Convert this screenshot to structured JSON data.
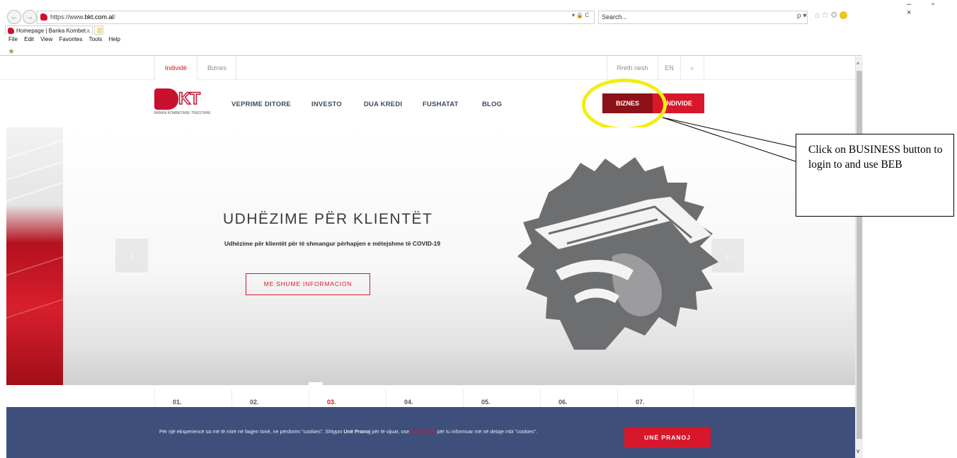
{
  "browser": {
    "url_prefix": "https://www.",
    "url_domain": "bkt.com.al",
    "url_suffix": "/",
    "address_tools": "▾ 🔒 C",
    "search_placeholder": "Search...",
    "search_dropdown": "ρ ▾",
    "tab_title": "Homepage | Banka Kombet...",
    "tab_close": "×",
    "menu": [
      "File",
      "Edit",
      "View",
      "Favorites",
      "Tools",
      "Help"
    ],
    "window_controls": "– ▫ ×"
  },
  "site": {
    "top_tabs": [
      "Individë",
      "Biznes"
    ],
    "top_links": [
      "Rreth nesh",
      "EN"
    ],
    "search_glyph": "⌕",
    "logo_letters": "KT",
    "logo_sub": "BANKA KOMBETARE TREGTARE",
    "nav": [
      "VEPRIME DITORE",
      "INVESTO",
      "DUA KREDI",
      "FUSHATAT",
      "BLOG"
    ],
    "btn_biznes": "BIZNES",
    "btn_individe": "INDIVIDE"
  },
  "hero": {
    "title": "UDHËZIME PËR KLIENTËT",
    "subtitle": "Udhëzime për klientët për të shmangur përhapjen e mëtejshme të COVID-19",
    "button": "ME SHUME INFORMACION",
    "arrow_left": "‹",
    "arrow_right": "›"
  },
  "slides": {
    "numbers": [
      "01.",
      "02.",
      "03.",
      "04.",
      "05.",
      "06.",
      "07."
    ],
    "active_index": 2
  },
  "cookie": {
    "text_part1": "Për një eksperiencë sa më të mirë në faqjen tonë, ne përdorim \"cookies\". Shtypni ",
    "text_bold": "Unë Pranoj",
    "text_part2": " për të vijuar, ose ",
    "link": "klikoni këtu",
    "text_part3": " për tu informuar më në detaje mbi \"cookies\".",
    "button": "UNË PRANOJ"
  },
  "annotation": {
    "callout_text": "Click on BUSINESS button to login to and use BEB",
    "highlight_color": "#f2ee12"
  },
  "colors": {
    "brand_red": "#d8172a",
    "dark_red": "#8c1118",
    "cookie_bg": "#3e4f7c"
  }
}
